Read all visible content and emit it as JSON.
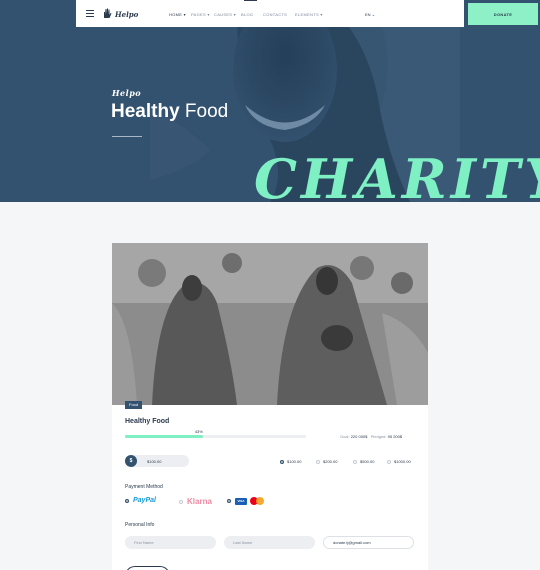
{
  "nav": {
    "brand": "Helpo",
    "menu": [
      "HOME",
      "PAGES",
      "CAUSES",
      "BLOG",
      "CONTACTS",
      "ELEMENTS"
    ],
    "lang": "EN",
    "donate": "DONATE"
  },
  "hero": {
    "brand": "Helpo",
    "title_bold": "Healthy",
    "title_rest": "Food",
    "big_word": "CHARITY"
  },
  "card": {
    "tag": "Food",
    "title": "Healthy Food",
    "progress_percent": 43,
    "progress_label": "43%",
    "goal_label": "Goal:",
    "goal_value": "220 000$",
    "pledged_label": "Pledged:",
    "pledged_value": "95 200$",
    "currency_symbol": "$",
    "amount_value": "$100.00",
    "preset_amounts": [
      "$100.00",
      "$200.00",
      "$500.00",
      "$1000.00"
    ],
    "payment_label": "Payment Method",
    "payment_options": [
      "PayPal",
      "Klarna"
    ],
    "visa_text": "VISA",
    "personal_label": "Personal Info",
    "first_name_placeholder": "First Name",
    "last_name_placeholder": "Last Name",
    "email_value": "donate.tj@gmail.com"
  },
  "colors": {
    "navy": "#33526f",
    "mint": "#7ef0c4",
    "klarna": "#f08aa4"
  }
}
